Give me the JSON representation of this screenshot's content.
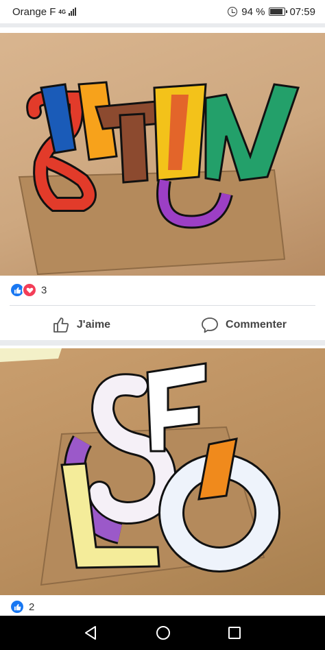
{
  "status_bar": {
    "carrier": "Orange F",
    "network": "4G",
    "battery": "94 %",
    "time": "07:59"
  },
  "posts": [
    {
      "photo": "Colorful 3D paper letters on cardboard",
      "reaction_count": "3",
      "actions": {
        "like_label": "J'aime",
        "comment_label": "Commenter"
      }
    },
    {
      "photo": "Patterned paper letters on cardboard",
      "reaction_count": "2"
    }
  ],
  "colors": {
    "like_blue": "#1877f2",
    "love_red": "#f33e58",
    "nav_bg": "#000000"
  },
  "icons": [
    "alarm-icon",
    "battery-icon",
    "like-reaction-icon",
    "love-reaction-icon",
    "thumbs-up-icon",
    "comment-icon",
    "back-icon",
    "home-icon",
    "recents-icon"
  ]
}
